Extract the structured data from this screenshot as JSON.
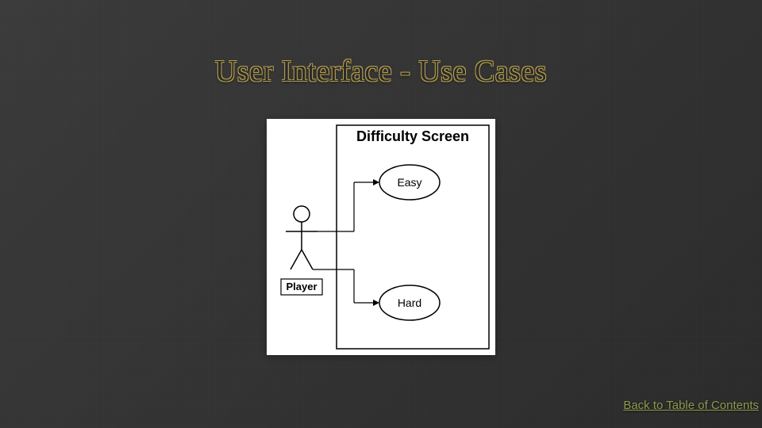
{
  "title": "User Interface - Use Cases",
  "diagram": {
    "system_label": "Difficulty Screen",
    "actor_label": "Player",
    "usecase_1": "Easy",
    "usecase_2": "Hard"
  },
  "nav": {
    "back_link": "Back to Table of Contents"
  }
}
